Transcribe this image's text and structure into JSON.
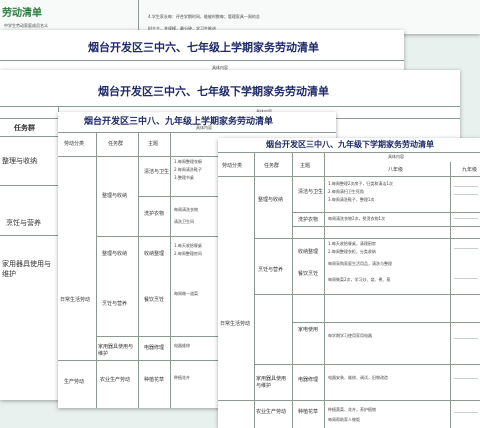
{
  "top_banner": {
    "left_text": "劳动清单",
    "left_sub": "中学生劳动家庭成员名义",
    "right_text": "4.学生家长每：评合学期时间，能被时数每；管理家具—周的总",
    "right_sub": "时主主，并规模，最分钟，学习生推进"
  },
  "sheet1": {
    "title": "烟台开发区三中六、七年级上学期家务劳动清单",
    "sub": "具体内容"
  },
  "sheet2": {
    "title": "烟台开发区三中六、七年级下学期家务劳动清单",
    "sub": "具体内容",
    "header_task": "任务群",
    "rows": [
      "整理与收纳",
      "烹饪与营养",
      "家用器具使用与维护"
    ]
  },
  "sheet3": {
    "title": "烟台开发区三中八、九年级上学期家务劳动清单",
    "sub": "具体内容",
    "headers": [
      "劳动分类",
      "任务群",
      "主题"
    ],
    "category_daily": "日常生活劳动",
    "category_prod": "生产劳动",
    "tasks": [
      "整理与收纳",
      "整理与收纳",
      "烹饪与营养",
      "家用器具使用与维护",
      "农业生产劳动"
    ],
    "topics": [
      "清洁与卫生",
      "洗护衣物",
      "收纳整理",
      "餐饮烹饪",
      "电器修理",
      "种植花草"
    ],
    "notes": [
      "1.每周整理衣橱",
      "2.每周清洗鞋子",
      "3.整理书桌",
      "每周清洗衣物",
      "清洗卫生间",
      "1.每天收拾餐桌",
      "2.每周整理房间",
      "每周做一道菜",
      "电器维修",
      "种植花卉"
    ]
  },
  "sheet4": {
    "title": "烟台开发区三中八、九年级下学期家务劳动清单",
    "sub": "具体内容",
    "col_eight": "八年级",
    "col_nine": "九年级",
    "headers": [
      "劳动分类",
      "任务群",
      "主题"
    ],
    "category_daily": "日常生活劳动",
    "tasks": [
      "整理与收纳",
      "烹饪与营养",
      "家用器具使用与维护",
      "农业生产劳动"
    ],
    "topics": [
      "清洁与卫生",
      "洗护衣物",
      "收纳整理",
      "餐饮烹饪",
      "家电使用",
      "电器修理",
      "种植花草"
    ],
    "cells": [
      "1.每周整理2次房子，归类和清洁1次",
      "2.每周清扫卫生死角",
      "3.每周清洗鞋子，整理1次",
      "每周清洗衣物2次，熨烫衣物1次",
      "1.每天收拾餐桌，清理厨房",
      "2.每周整理衣柜，分类收纳",
      "每周采购家庭生活用品，清洗与整理",
      "每周做菜2次，学习炒、烧、煮、蒸",
      "每学期学习使用家用电器",
      "电器安装、维修、调试，旧物改造",
      "种植蔬菜、花卉，养护植物",
      "每周帮助家人做饭"
    ]
  },
  "colors": {
    "background": "#e9f1ee",
    "title": "#1e2a6a",
    "accent_green": "#2b7d3e"
  }
}
